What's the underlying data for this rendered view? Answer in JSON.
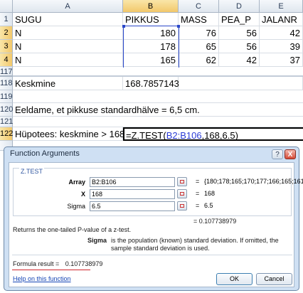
{
  "columns": [
    "A",
    "B",
    "C",
    "D",
    "E"
  ],
  "rows": [
    {
      "num": "1",
      "a": "SUGU",
      "b": "PIKKUS",
      "c": "MASS",
      "d": "PEA_P",
      "e": "JALANR"
    },
    {
      "num": "2",
      "a": "N",
      "b": "180",
      "c": "76",
      "d": "56",
      "e": "42"
    },
    {
      "num": "3",
      "a": "N",
      "b": "178",
      "c": "65",
      "d": "56",
      "e": "39"
    },
    {
      "num": "4",
      "a": "N",
      "b": "165",
      "c": "62",
      "d": "42",
      "e": "37"
    }
  ],
  "row117": "117",
  "row118": {
    "num": "118",
    "label": "Keskmine",
    "value": "168.7857143"
  },
  "row119": "119",
  "row120": {
    "num": "120",
    "text": "Eeldame, et pikkuse standardhälve = 6,5 cm."
  },
  "row121": "121",
  "row122": {
    "num": "122",
    "label": "Hüpotees: keskmine > 168",
    "formula_pre": "=Z.TEST(",
    "formula_ref": "B2:B106",
    "formula_post": ",168,6.5)"
  },
  "dialog": {
    "title": "Function Arguments",
    "help_glyph": "?",
    "close_glyph": "X",
    "function_name": "Z.TEST",
    "args": [
      {
        "label": "Array",
        "value": "B2:B106",
        "result": "{180;178;165;170;177;166;165;161;16"
      },
      {
        "label": "X",
        "value": "168",
        "result": "168"
      },
      {
        "label": "Sigma",
        "value": "6.5",
        "result": "6.5"
      }
    ],
    "overall_result": "= 0.107738979",
    "description": "Returns the one-tailed P-value of a z-test.",
    "arg_desc_name": "Sigma",
    "arg_desc_text": "is the population (known) standard deviation. If omitted, the sample standard deviation is used.",
    "formula_result_label": "Formula result =",
    "formula_result_value": "0.107738979",
    "help_link": "Help on this function",
    "ok_label": "OK",
    "cancel_label": "Cancel"
  }
}
